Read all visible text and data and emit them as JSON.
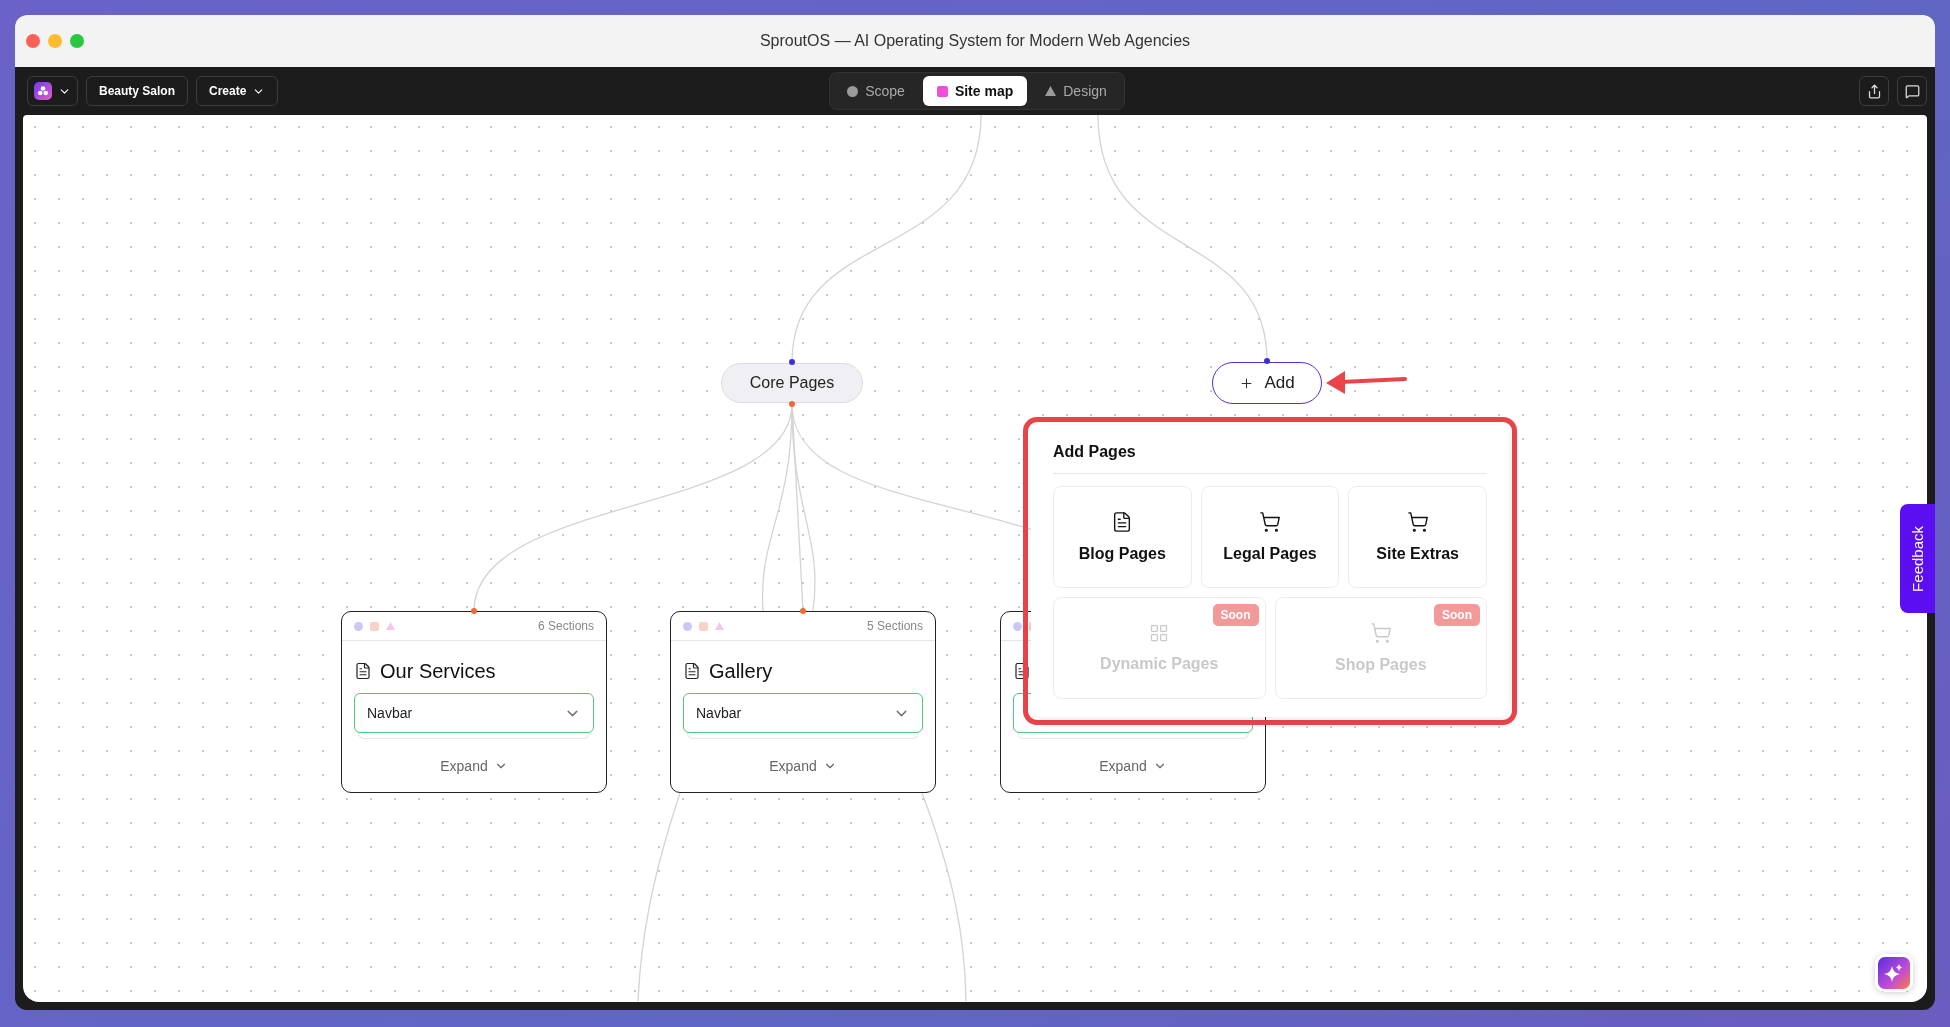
{
  "window": {
    "title": "SproutOS — AI Operating System for Modern Web Agencies"
  },
  "toolbar": {
    "project": "Beauty Salon",
    "create": "Create",
    "tabs": [
      {
        "label": "Scope",
        "selected": false
      },
      {
        "label": "Site map",
        "selected": true
      },
      {
        "label": "Design",
        "selected": false
      }
    ]
  },
  "canvas": {
    "group_node": {
      "label": "Core Pages"
    },
    "add_button": {
      "label": "Add"
    },
    "pages": [
      {
        "sections": "6 Sections",
        "title": "Our Services",
        "field": "Navbar",
        "expand": "Expand"
      },
      {
        "sections": "5 Sections",
        "title": "Gallery",
        "field": "Navbar",
        "expand": "Expand"
      },
      {
        "expand": "Expand"
      }
    ],
    "add_pages": {
      "title": "Add Pages",
      "options": [
        {
          "label": "Blog Pages",
          "disabled": false
        },
        {
          "label": "Legal Pages",
          "disabled": false
        },
        {
          "label": "Site Extras",
          "disabled": false
        },
        {
          "label": "Dynamic Pages",
          "disabled": true,
          "badge": "Soon"
        },
        {
          "label": "Shop Pages",
          "disabled": true,
          "badge": "Soon"
        }
      ]
    }
  },
  "feedback": {
    "label": "Feedback"
  }
}
